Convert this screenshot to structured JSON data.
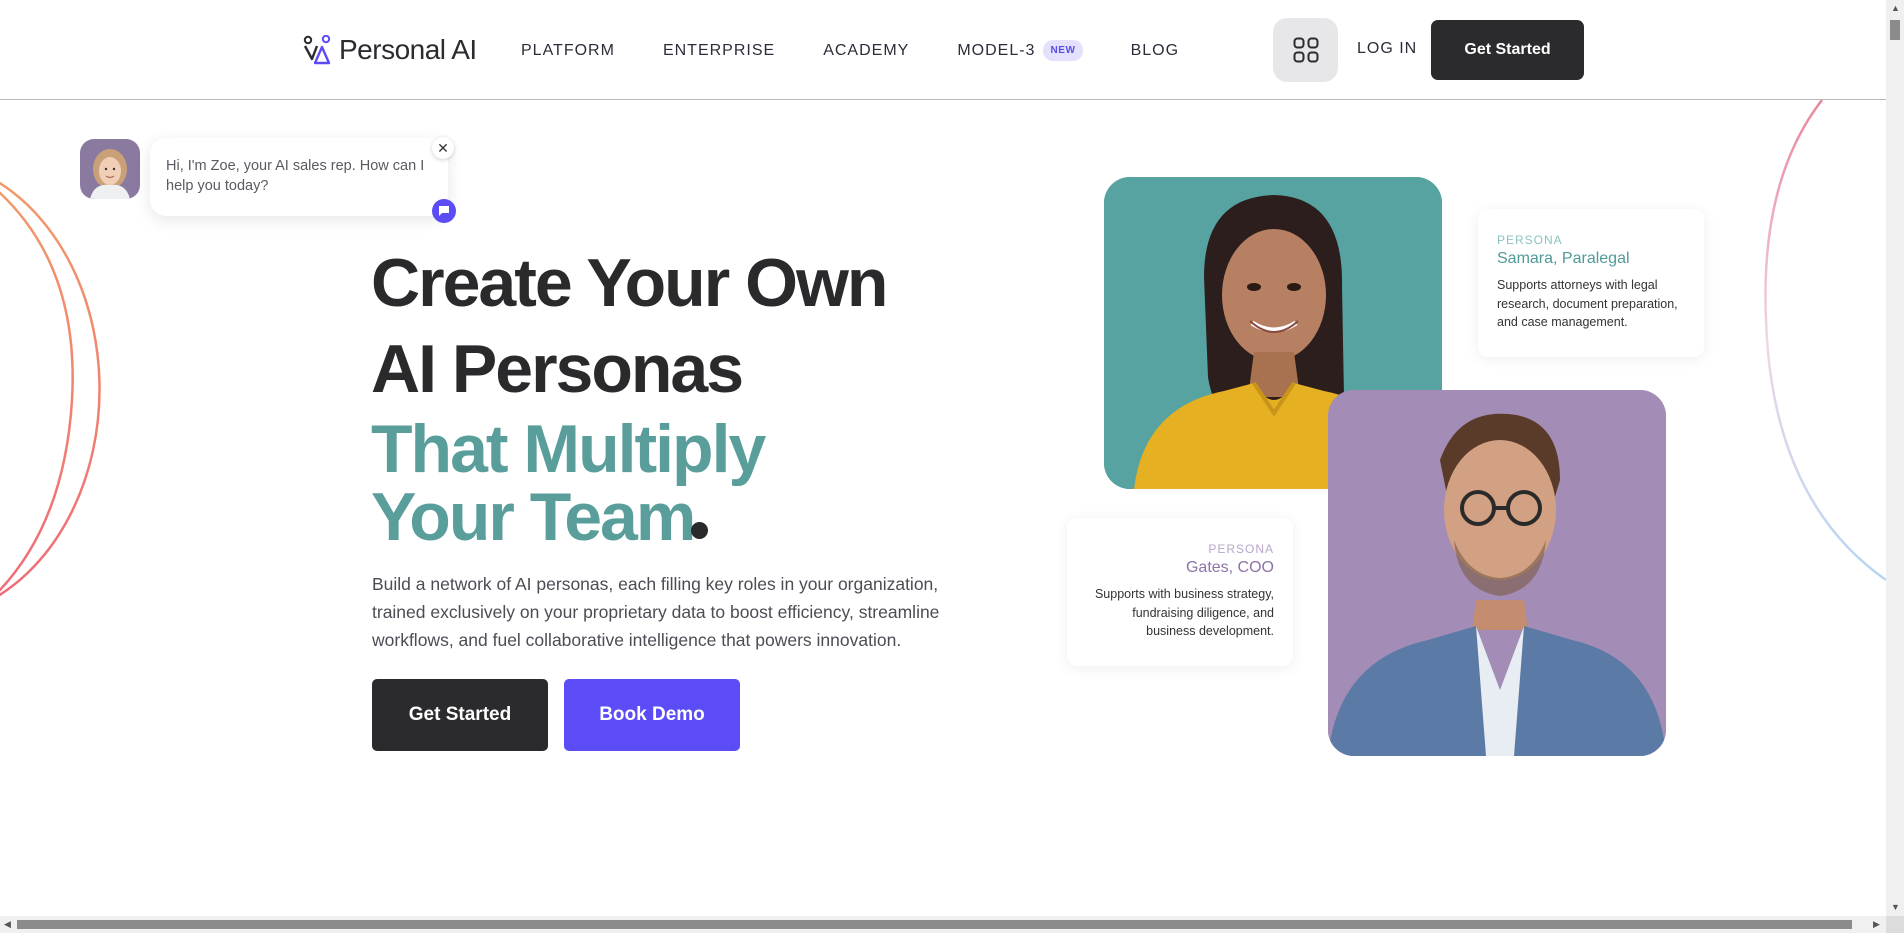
{
  "header": {
    "logo_text": "Personal AI",
    "menu": [
      {
        "label": "PLATFORM"
      },
      {
        "label": "ENTERPRISE"
      },
      {
        "label": "ACADEMY"
      },
      {
        "label": "MODEL-3",
        "badge": "NEW"
      },
      {
        "label": "BLOG"
      }
    ],
    "login_label": "LOG IN",
    "cta_label": "Get Started"
  },
  "chat": {
    "message": "Hi, I'm Zoe, your AI sales rep. How can I help you today?",
    "close_glyph": "✕"
  },
  "hero": {
    "line1": "Create Your Own",
    "line2": "AI Personas",
    "line3": "That Multiply",
    "line4": "Your Team",
    "description": "Build a network of AI personas, each filling key roles in your organization, trained exclusively on your proprietary data to boost efficiency, streamline workflows, and fuel collaborative intelligence that powers innovation.",
    "primary_button": "Get Started",
    "secondary_button": "Book Demo"
  },
  "personas": [
    {
      "label": "PERSONA",
      "name": "Samara, Paralegal",
      "description": "Supports attorneys with legal research, document preparation, and case management."
    },
    {
      "label": "PERSONA",
      "name": "Gates, COO",
      "description": "Supports with business strategy, fundraising diligence, and business development."
    }
  ],
  "colors": {
    "dark": "#2b2b2e",
    "teal": "#5a9e9b",
    "accent": "#5b4cf5",
    "badge_bg": "#e4e1ff",
    "arc_left": "#f0886a",
    "arc_right_top": "#e8869a",
    "arc_right_bottom": "#b6d6f2"
  },
  "icons": {
    "apps": "apps-grid-icon",
    "chat": "chat-icon",
    "close": "close-icon"
  }
}
